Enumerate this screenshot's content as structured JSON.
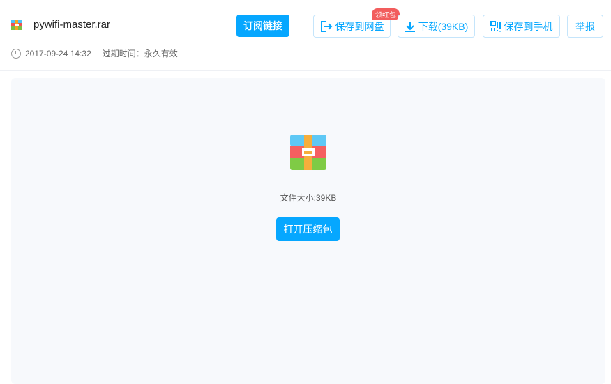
{
  "file": {
    "name": "pywifi-master.rar",
    "date": "2017-09-24 14:32",
    "expire": "过期时间：永久有效",
    "size_text": "文件大小:39KB"
  },
  "toolbar": {
    "subscribe": "订阅链接",
    "save_cloud": "保存到网盘",
    "badge": "领红包",
    "download": "下载(39KB)",
    "save_phone": "保存到手机",
    "report": "举报"
  },
  "main": {
    "open_button": "打开压缩包"
  },
  "colors": {
    "accent": "#06a7ff",
    "badge": "#f25d5d"
  }
}
